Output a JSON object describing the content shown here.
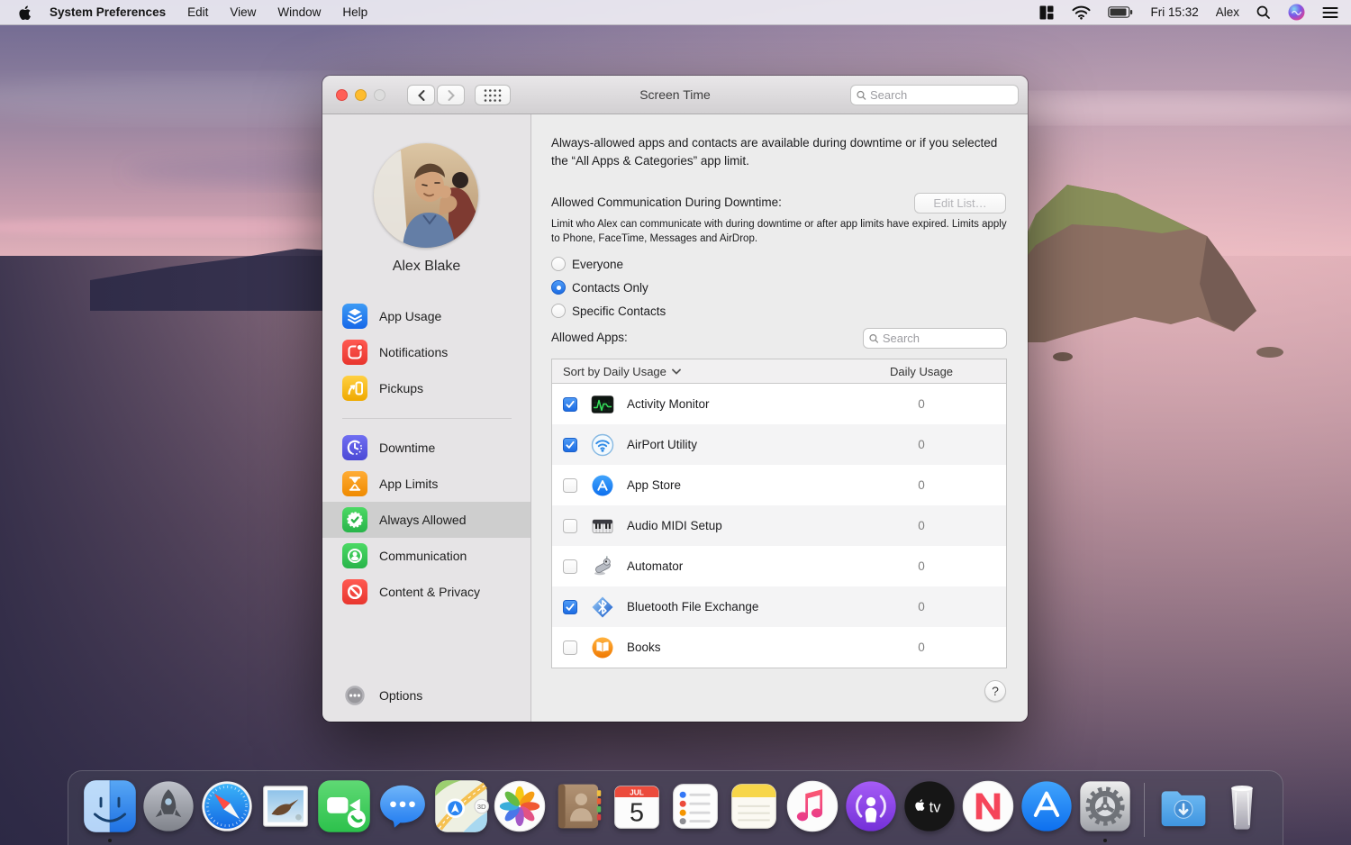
{
  "menu_bar": {
    "app_name": "System Preferences",
    "menus": [
      "Edit",
      "View",
      "Window",
      "Help"
    ],
    "status": {
      "clock": "Fri 15:32",
      "user": "Alex"
    }
  },
  "window": {
    "title": "Screen Time",
    "toolbar_search_placeholder": "Search",
    "sidebar": {
      "profile_name": "Alex Blake",
      "items": [
        {
          "label": "App Usage",
          "icon": "app-usage-icon",
          "selected": false
        },
        {
          "label": "Notifications",
          "icon": "notifications-icon",
          "selected": false
        },
        {
          "label": "Pickups",
          "icon": "pickups-icon",
          "selected": false
        },
        {
          "label": "Downtime",
          "icon": "downtime-icon",
          "selected": false
        },
        {
          "label": "App Limits",
          "icon": "app-limits-icon",
          "selected": false
        },
        {
          "label": "Always Allowed",
          "icon": "always-allowed-icon",
          "selected": true
        },
        {
          "label": "Communication",
          "icon": "communication-icon",
          "selected": false
        },
        {
          "label": "Content & Privacy",
          "icon": "content-privacy-icon",
          "selected": false
        }
      ],
      "options_label": "Options"
    },
    "main": {
      "intro": "Always-allowed apps and contacts are available during downtime or if you selected the “All Apps & Categories” app limit.",
      "comm_label": "Allowed Communication During Downtime:",
      "edit_list_button": "Edit List…",
      "comm_desc": "Limit who Alex can communicate with during downtime or after app limits have expired. Limits apply to Phone, FaceTime, Messages and AirDrop.",
      "radios": [
        {
          "label": "Everyone",
          "selected": false
        },
        {
          "label": "Contacts Only",
          "selected": true
        },
        {
          "label": "Specific Contacts",
          "selected": false
        }
      ],
      "allowed_apps_label": "Allowed Apps:",
      "apps_search_placeholder": "Search",
      "table": {
        "sort_header": "Sort by Daily Usage",
        "usage_header": "Daily Usage",
        "rows": [
          {
            "app": "Activity Monitor",
            "checked": true,
            "usage": "0"
          },
          {
            "app": "AirPort Utility",
            "checked": true,
            "usage": "0"
          },
          {
            "app": "App Store",
            "checked": false,
            "usage": "0"
          },
          {
            "app": "Audio MIDI Setup",
            "checked": false,
            "usage": "0"
          },
          {
            "app": "Automator",
            "checked": false,
            "usage": "0"
          },
          {
            "app": "Bluetooth File Exchange",
            "checked": true,
            "usage": "0"
          },
          {
            "app": "Books",
            "checked": false,
            "usage": "0"
          }
        ]
      },
      "help_button": "?"
    }
  },
  "dock": {
    "items": [
      "Finder",
      "Launchpad",
      "Safari",
      "Mail",
      "FaceTime",
      "Messages",
      "Maps",
      "Photos",
      "Contacts",
      "Calendar",
      "Reminders",
      "Notes",
      "Music",
      "Podcasts",
      "TV",
      "News",
      "App Store",
      "System Preferences",
      "Downloads",
      "Trash"
    ],
    "running": [
      "Finder",
      "System Preferences"
    ],
    "calendar": {
      "month": "JUL",
      "day": "5"
    },
    "tv_label": "tv",
    "maps_badge": "3D"
  },
  "colors": {
    "accent_blue": "#1c6ce3",
    "checkbox_blue": "#2a7aef",
    "sidebar_selected": "#cecece",
    "window_bg": "#ececec",
    "titlebar_top": "#e9e7e9"
  }
}
